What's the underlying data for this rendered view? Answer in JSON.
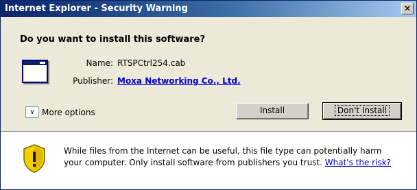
{
  "window": {
    "title": "Internet Explorer - Security Warning",
    "close_label": "×"
  },
  "heading": "Do you want to install this software?",
  "info": {
    "name_label": "Name:",
    "name_value": "RTSPCtrl254.cab",
    "publisher_label": "Publisher:",
    "publisher_value": "Moxa Networking Co., Ltd."
  },
  "more_options": {
    "label": "More options",
    "icon": "chevron-double-down-icon"
  },
  "buttons": {
    "install": "Install",
    "dont_install": "Don't Install"
  },
  "warning": {
    "line1": "While files from the Internet can be useful, this file type can potentially harm",
    "line2": "your computer. Only install software from publishers you trust.",
    "link": "What's the risk?",
    "icon": "shield-warning-icon"
  }
}
